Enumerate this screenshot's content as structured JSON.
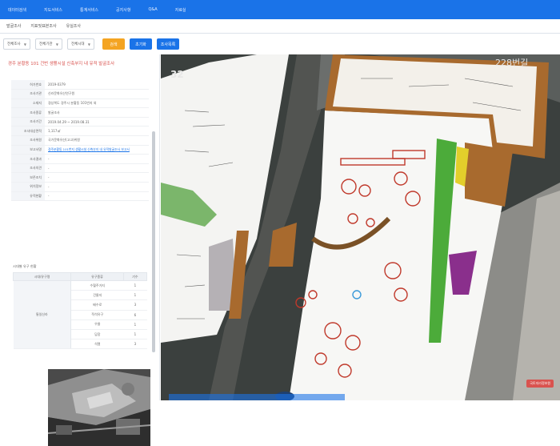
{
  "topnav": {
    "items": [
      "데이터검색",
      "지도서비스",
      "통계서비스",
      "공지사항",
      "Q&A",
      "자료실"
    ]
  },
  "subnav": {
    "items": [
      "발굴조사",
      "지표및표본조사",
      "유실조사"
    ]
  },
  "toolbar": {
    "selects": [
      "전체조사",
      "전체기관",
      "전체시대"
    ],
    "buttons": {
      "search": "검색",
      "reset": "초기화",
      "list": "조사목록"
    }
  },
  "panel": {
    "title": "경주 분황동 101 건번 생활시설 신축부지 내 유적 발굴조사",
    "info": [
      {
        "key": "허가번호",
        "value": "2019-0379"
      },
      {
        "key": "조사기관",
        "value": "신라문화유산연구원"
      },
      {
        "key": "소재지",
        "value": "경상북도 경주시 분황동 101번지 외"
      },
      {
        "key": "조사종류",
        "value": "발굴조사"
      },
      {
        "key": "조사기간",
        "value": "2019.04.29 ~ 2019.08.31"
      },
      {
        "key": "조사대상면적",
        "value": "1,117㎡"
      },
      {
        "key": "조사위원",
        "value": "국가문화유산(고고)위원"
      },
      {
        "key": "보고서명",
        "value": "경주분황동 101번지 생활시설 신축부지 내 유적발굴조사 보고서",
        "link": true
      },
      {
        "key": "조사결과",
        "value": "-"
      },
      {
        "key": "조사의견",
        "value": "-"
      },
      {
        "key": "보존조치",
        "value": "-"
      },
      {
        "key": "위치정보",
        "value": "-"
      },
      {
        "key": "유적현황",
        "value": "-"
      }
    ],
    "features_label": "시대별 유구 현황",
    "features_headers": [
      "시대/유구명",
      "유구종류",
      "기수"
    ],
    "features_group": "통일신라",
    "features": [
      {
        "type": "수혈주거지",
        "count": "1"
      },
      {
        "type": "건물지",
        "count": "1"
      },
      {
        "type": "배수로",
        "count": "3"
      },
      {
        "type": "적석유구",
        "count": "6"
      },
      {
        "type": "우물",
        "count": "1"
      },
      {
        "type": "담장",
        "count": "1"
      },
      {
        "type": "석렬",
        "count": "3"
      }
    ]
  },
  "map": {
    "block_number": "32",
    "road_label": "228번길",
    "badge": "국토지리정보원",
    "colors": {
      "road": "#4a4a48",
      "orange": "#a86a2e",
      "green": "#4cab3a",
      "purple": "#8a2f8c",
      "red": "#c0392b",
      "marker": "#3a9ad9"
    }
  }
}
